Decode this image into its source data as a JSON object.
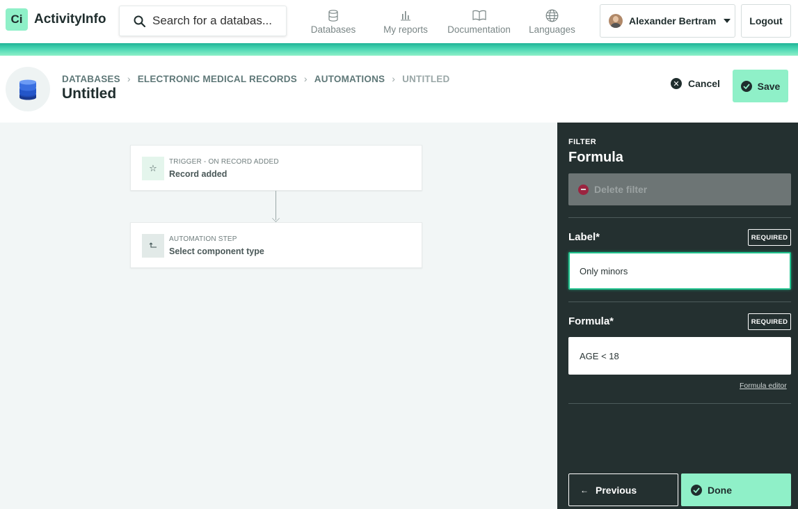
{
  "app": {
    "name": "ActivityInfo",
    "logo_glyph": "Ci",
    "brand_color": "#8ff0c8"
  },
  "search": {
    "placeholder": "Search for a databas..."
  },
  "nav": [
    {
      "label": "Databases",
      "icon": "database-icon"
    },
    {
      "label": "My reports",
      "icon": "bar-chart-icon"
    },
    {
      "label": "Documentation",
      "icon": "book-icon"
    },
    {
      "label": "Languages",
      "icon": "globe-icon"
    }
  ],
  "user": {
    "name": "Alexander Bertram",
    "logout_label": "Logout"
  },
  "breadcrumb": [
    "DATABASES",
    "ELECTRONIC MEDICAL RECORDS",
    "AUTOMATIONS",
    "UNTITLED"
  ],
  "page": {
    "title": "Untitled",
    "cancel_label": "Cancel",
    "save_label": "Save"
  },
  "canvas": {
    "trigger": {
      "label": "TRIGGER - ON RECORD ADDED",
      "value": "Record added",
      "icon": "star-icon"
    },
    "step": {
      "label": "AUTOMATION STEP",
      "value": "Select component type",
      "icon": "return-arrow-icon"
    }
  },
  "panel": {
    "kicker": "FILTER",
    "title": "Formula",
    "delete_label": "Delete filter",
    "label_field": {
      "label": "Label*",
      "badge": "REQUIRED",
      "value": "Only minors"
    },
    "formula_field": {
      "label": "Formula*",
      "badge": "REQUIRED",
      "value": "AGE < 18"
    },
    "formula_editor_label": "Formula editor",
    "previous_label": "Previous",
    "done_label": "Done"
  }
}
